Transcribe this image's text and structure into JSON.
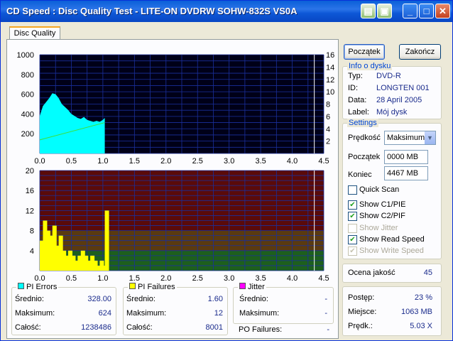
{
  "window": {
    "title": "CD Speed : Disc Quality Test - LITE-ON DVDRW SOHW-832S  VS0A"
  },
  "tab": {
    "label": "Disc Quality"
  },
  "buttons": {
    "start": "Początek",
    "exit": "Zakończ"
  },
  "disc_info": {
    "legend": "Info o dysku",
    "type_label": "Typ:",
    "type_value": "DVD-R",
    "id_label": "ID:",
    "id_value": "LONGTEN 001",
    "date_label": "Data:",
    "date_value": "28 April 2005",
    "label_label": "Label:",
    "label_value": "Mój dysk"
  },
  "settings": {
    "legend": "Settings",
    "speed_label": "Prędkość",
    "speed_value": "Maksimum",
    "start_label": "Początek",
    "start_value": "0000 MB",
    "end_label": "Koniec",
    "end_value": "4467 MB",
    "quick_scan": "Quick Scan",
    "show_c1": "Show C1/PIE",
    "show_c2": "Show C2/PIF",
    "show_jitter": "Show Jitter",
    "show_read": "Show Read Speed",
    "show_write": "Show Write Speed"
  },
  "quality": {
    "label": "Ocena jakość",
    "value": "45"
  },
  "progress": {
    "progress_label": "Postęp:",
    "progress_value": "23 %",
    "position_label": "Miejsce:",
    "position_value": "1063 MB",
    "speed_label": "Prędk.:",
    "speed_value": "5.03 X"
  },
  "pi_errors": {
    "legend": "PI Errors",
    "color": "#00ffff",
    "avg_label": "Średnio:",
    "avg_value": "328.00",
    "max_label": "Maksimum:",
    "max_value": "624",
    "total_label": "Całość:",
    "total_value": "1238486"
  },
  "pi_failures": {
    "legend": "PI Failures",
    "color": "#ffff00",
    "avg_label": "Średnio:",
    "avg_value": "1.60",
    "max_label": "Maksimum:",
    "max_value": "12",
    "total_label": "Całość:",
    "total_value": "8001"
  },
  "jitter": {
    "legend": "Jitter",
    "color": "#ff00ff",
    "avg_label": "Średnio:",
    "avg_value": "-",
    "max_label": "Maksimum:",
    "max_value": "-",
    "po_label": "PO Failures:",
    "po_value": "-"
  },
  "chart_data": [
    {
      "type": "area",
      "x_ticks": [
        "0.0",
        "0.5",
        "1.0",
        "1.5",
        "2.0",
        "2.5",
        "3.0",
        "3.5",
        "4.0",
        "4.5"
      ],
      "y_left_ticks": [
        "1000",
        "800",
        "600",
        "400",
        "200"
      ],
      "y_right_ticks": [
        "16",
        "14",
        "12",
        "10",
        "8",
        "6",
        "4",
        "2"
      ],
      "ylim": [
        0,
        1000
      ],
      "xlim": [
        0,
        4.5
      ],
      "series": [
        {
          "x": [
            0.0,
            0.05,
            0.1,
            0.15,
            0.2,
            0.25,
            0.3,
            0.35,
            0.4,
            0.45,
            0.5,
            0.55,
            0.6,
            0.65,
            0.7,
            0.75,
            0.8,
            0.85,
            0.9,
            0.95,
            1.0,
            1.03
          ],
          "y": [
            380,
            480,
            520,
            560,
            610,
            600,
            560,
            500,
            470,
            440,
            400,
            380,
            360,
            350,
            370,
            340,
            330,
            320,
            330,
            320,
            340,
            360
          ]
        }
      ],
      "read_speed": {
        "x": [
          0.0,
          1.03
        ],
        "y": [
          2.2,
          5.0
        ]
      }
    },
    {
      "type": "bar",
      "x_ticks": [
        "0.0",
        "0.5",
        "1.0",
        "1.5",
        "2.0",
        "2.5",
        "3.0",
        "3.5",
        "4.0",
        "4.5"
      ],
      "y_ticks": [
        "20",
        "16",
        "12",
        "8",
        "4"
      ],
      "ylim": [
        0,
        20
      ],
      "xlim": [
        0,
        4.5
      ],
      "series": [
        {
          "x": [
            0.0,
            0.05,
            0.1,
            0.15,
            0.2,
            0.25,
            0.3,
            0.35,
            0.4,
            0.45,
            0.5,
            0.55,
            0.6,
            0.65,
            0.7,
            0.75,
            0.8,
            0.85,
            0.9,
            0.95,
            1.0,
            1.03
          ],
          "y": [
            6,
            10,
            8,
            7,
            9,
            5,
            7,
            4,
            3,
            4,
            3,
            2,
            3,
            4,
            3,
            2,
            3,
            2,
            1,
            2,
            1,
            12
          ]
        }
      ],
      "zones": [
        {
          "from": 0,
          "to": 4,
          "color": "#1d5f1d"
        },
        {
          "from": 4,
          "to": 8,
          "color": "#5a3a10"
        },
        {
          "from": 8,
          "to": 20,
          "color": "#5a0a0a"
        }
      ]
    }
  ],
  "colors": {
    "title_bar": "#0a5fd8",
    "grid": "#1a2f9c",
    "pie_fill": "#00ffff",
    "pif_fill": "#ffff00"
  }
}
